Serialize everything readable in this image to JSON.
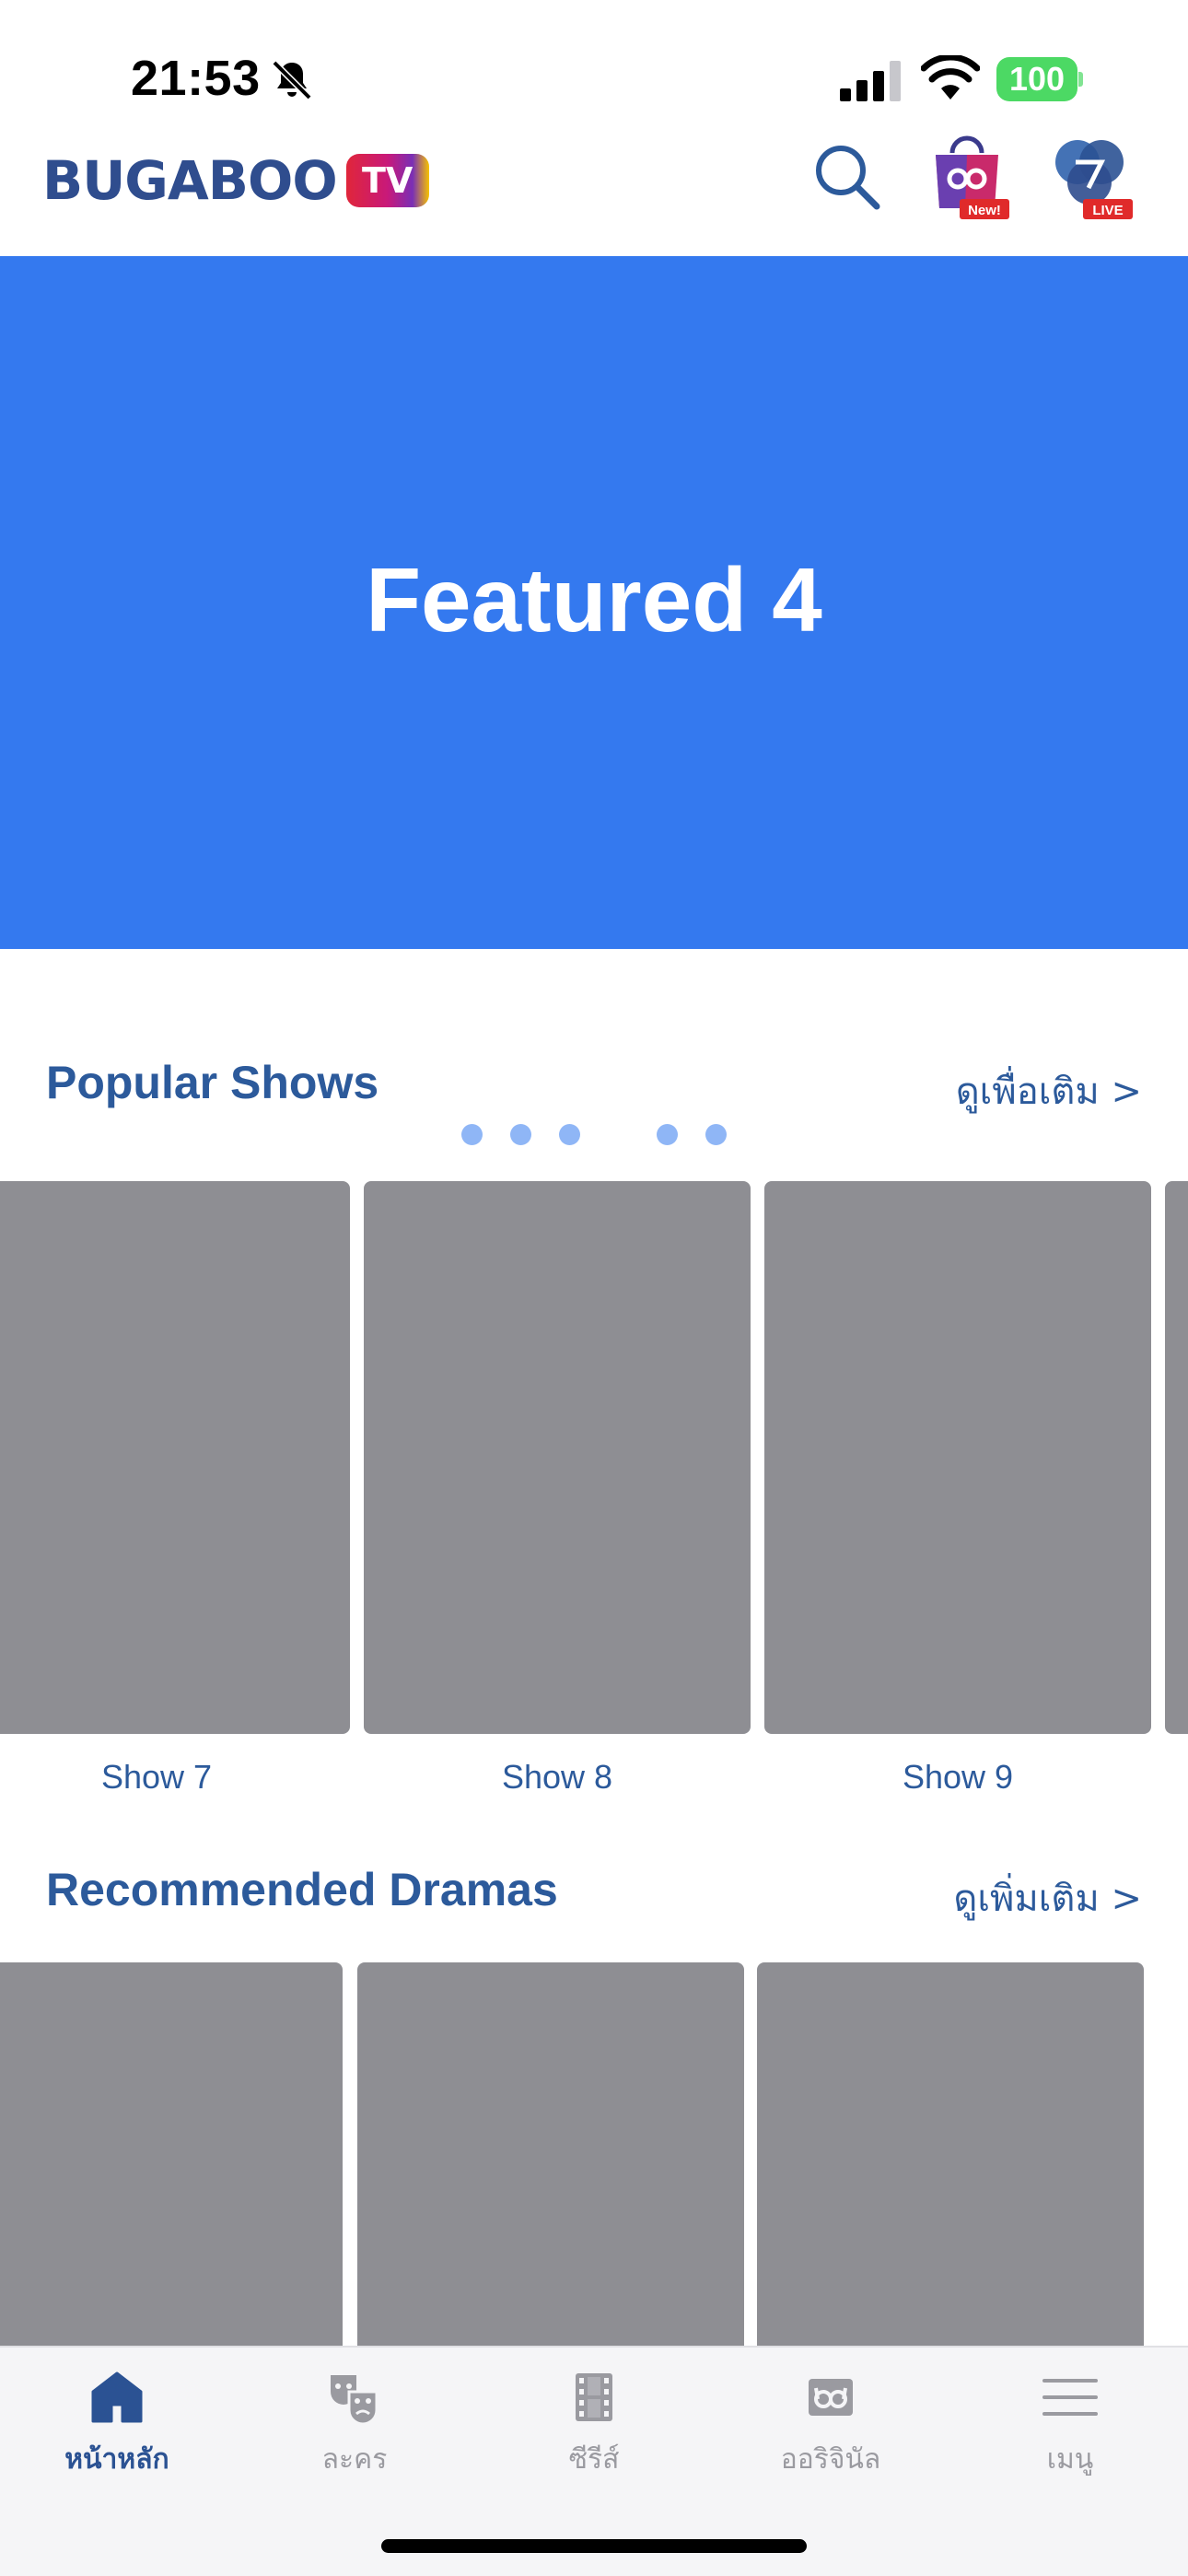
{
  "status_bar": {
    "time": "21:53",
    "battery": "100",
    "icons": [
      "bell-slash-icon",
      "cellular-signal-icon",
      "wifi-icon",
      "battery-icon"
    ]
  },
  "header": {
    "logo_text": "BUGABOO",
    "logo_badge": "TV",
    "shop_badge": "New!",
    "live_badge": "LIVE",
    "icons": [
      "search-icon",
      "shopping-bag-icon",
      "ch7-live-icon"
    ]
  },
  "banner": {
    "title": "Featured 4",
    "slide_count": 6,
    "active_slide": 4,
    "color": "#3479ef"
  },
  "popular": {
    "title": "Popular Shows",
    "see_more": "ดูเพื่อเติม >",
    "items": [
      {
        "label": "Show 7"
      },
      {
        "label": "Show 8"
      },
      {
        "label": "Show 9"
      }
    ]
  },
  "recommended": {
    "title": "Recommended Dramas",
    "see_more": "ดูเพิ่มเติม >"
  },
  "tabbar": {
    "tabs": [
      {
        "label": "หน้าหลัก",
        "icon": "home-icon",
        "active": true
      },
      {
        "label": "ละคร",
        "icon": "theater-masks-icon",
        "active": false
      },
      {
        "label": "ซีรีส์",
        "icon": "film-strip-icon",
        "active": false
      },
      {
        "label": "ออริจินัล",
        "icon": "bugaboo-originals-icon",
        "active": false
      },
      {
        "label": "เมนู",
        "icon": "hamburger-menu-icon",
        "active": false
      }
    ]
  },
  "colors": {
    "accent": "#2c5a9b",
    "placeholder": "#8e8e93",
    "battery": "#4cd964"
  }
}
